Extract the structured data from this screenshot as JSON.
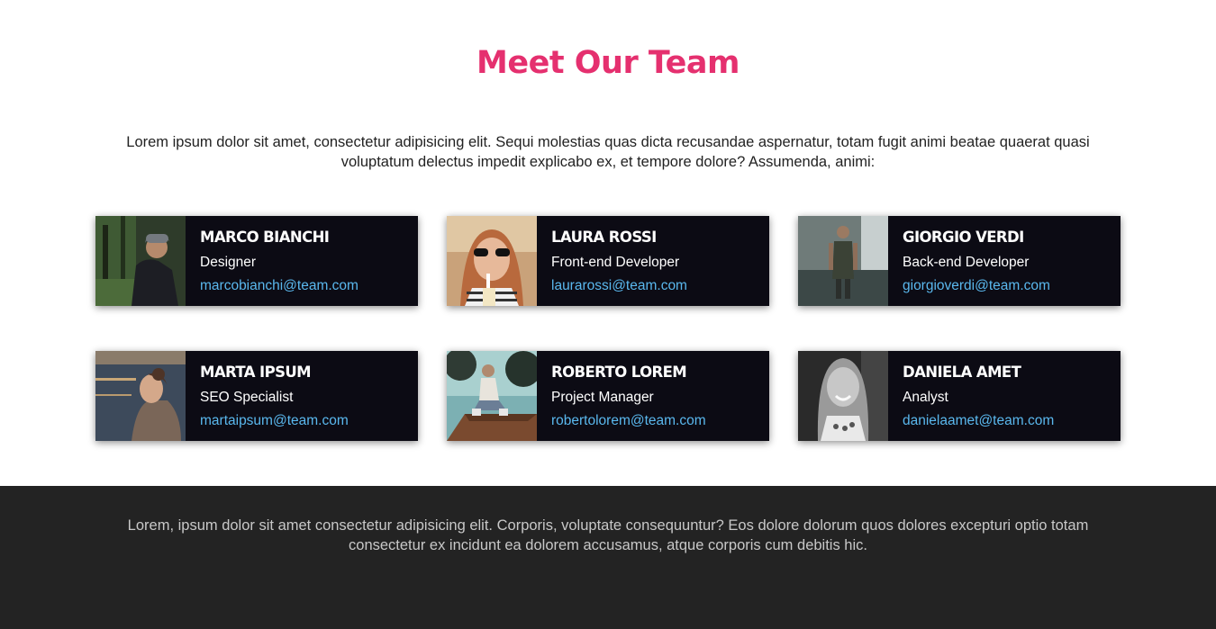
{
  "header": {
    "title": "Meet Our Team",
    "intro": "Lorem ipsum dolor sit amet, consectetur adipisicing elit. Sequi molestias quas dicta recusandae aspernatur, totam fugit animi beatae quaerat quasi voluptatum delectus impedit explicabo ex, et tempore dolore? Assumenda, animi:"
  },
  "team": [
    {
      "name": "MARCO BIANCHI",
      "role": "Designer",
      "email": "marcobianchi@team.com"
    },
    {
      "name": "LAURA ROSSI",
      "role": "Front-end Developer",
      "email": "laurarossi@team.com"
    },
    {
      "name": "GIORGIO VERDI",
      "role": "Back-end Developer",
      "email": "giorgioverdi@team.com"
    },
    {
      "name": "MARTA IPSUM",
      "role": "SEO Specialist",
      "email": "martaipsum@team.com"
    },
    {
      "name": "ROBERTO LOREM",
      "role": "Project Manager",
      "email": "robertolorem@team.com"
    },
    {
      "name": "DANIELA AMET",
      "role": "Analyst",
      "email": "danielaamet@team.com"
    }
  ],
  "footer": {
    "text": "Lorem, ipsum dolor sit amet consectetur adipisicing elit. Corporis, voluptate consequuntur? Eos dolore dolorum quos dolores excepturi optio totam consectetur ex incidunt ea dolorem accusamus, atque corporis cum debitis hic."
  },
  "colors": {
    "accent": "#e5306f",
    "card_bg": "#0c0b14",
    "link": "#5ab8ee",
    "footer_bg": "#232323"
  }
}
